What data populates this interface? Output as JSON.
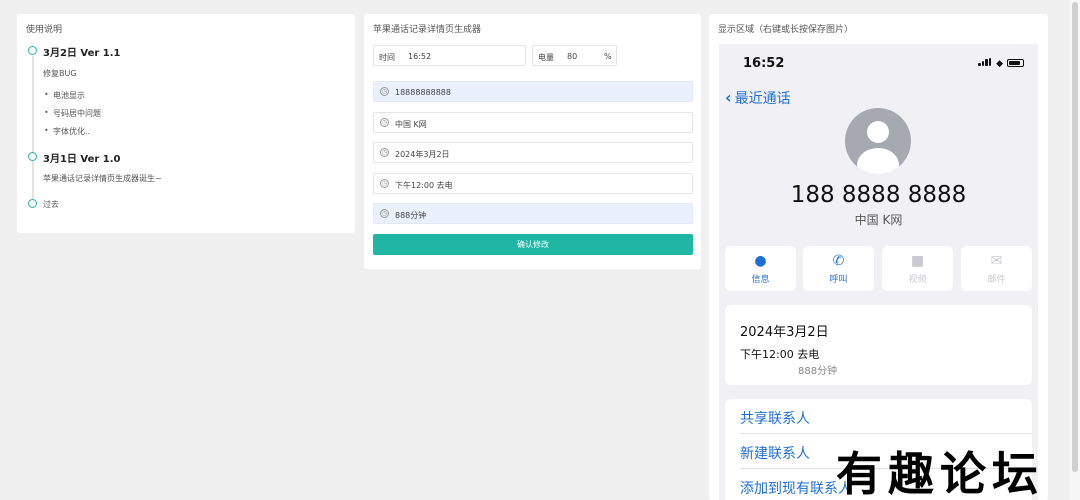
{
  "left_panel": {
    "title": "使用说明",
    "entries": [
      {
        "version": "3月2日 Ver 1.1",
        "note": "修复BUG",
        "bullets": [
          "电池显示",
          "号码居中问题",
          "字体优化.."
        ]
      },
      {
        "version": "3月1日 Ver 1.0",
        "note": "苹果通话记录详情页生成器诞生~"
      },
      {
        "version": "过去"
      }
    ]
  },
  "mid_panel": {
    "title": "苹果通话记录详情页生成器",
    "time_label": "时间",
    "time_value": "16:52",
    "battery_label": "电量",
    "battery_value": "80",
    "battery_unit": "%",
    "rows": [
      "18888888888",
      "中国 K网",
      "2024年3月2日",
      "下午12:00 去电",
      "888分钟"
    ],
    "confirm_label": "确认修改"
  },
  "right_panel": {
    "title": "显示区域（右键或长按保存图片）",
    "phone": {
      "status_time": "16:52",
      "back_label": "最近通话",
      "number": "188 8888 8888",
      "carrier": "中国 K网",
      "actions": [
        {
          "label": "信息",
          "icon": "message-icon",
          "active": true
        },
        {
          "label": "呼叫",
          "icon": "phone-icon",
          "active": true
        },
        {
          "label": "视频",
          "icon": "video-icon",
          "active": false
        },
        {
          "label": "邮件",
          "icon": "mail-icon",
          "active": false
        }
      ],
      "call_date": "2024年3月2日",
      "call_time": "下午12:00  去电",
      "call_duration": "888分钟",
      "links": [
        "共享联系人",
        "新建联系人",
        "添加到现有联系人"
      ]
    }
  },
  "watermark": "有趣论坛",
  "colors": {
    "accent": "#1fb7a4",
    "ios_blue": "#1f6fd6",
    "highlight_row": "#eaf0fc"
  }
}
